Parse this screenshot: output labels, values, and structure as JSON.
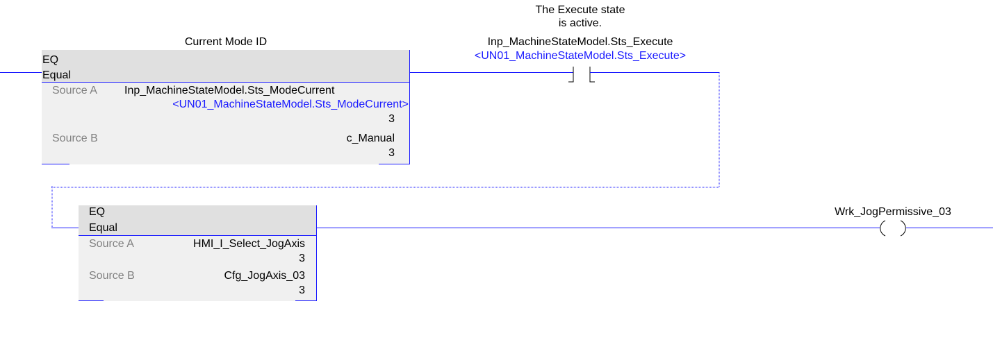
{
  "rung1": {
    "eq_block": {
      "caption": "Current Mode ID",
      "mnemonic": "EQ",
      "name": "Equal",
      "source_a_label": "Source A",
      "source_a_tag": "Inp_MachineStateModel.Sts_ModeCurrent",
      "source_a_alias": "<UN01_MachineStateModel.Sts_ModeCurrent>",
      "source_a_value": "3",
      "source_b_label": "Source B",
      "source_b_tag": "c_Manual",
      "source_b_value": "3"
    },
    "contact": {
      "description_line1": "The Execute state",
      "description_line2": "is active.",
      "tag": "Inp_MachineStateModel.Sts_Execute",
      "alias": "<UN01_MachineStateModel.Sts_Execute>"
    }
  },
  "rung2": {
    "eq_block": {
      "mnemonic": "EQ",
      "name": "Equal",
      "source_a_label": "Source A",
      "source_a_tag": "HMI_I_Select_JogAxis",
      "source_a_value": "3",
      "source_b_label": "Source B",
      "source_b_tag": "Cfg_JogAxis_03",
      "source_b_value": "3"
    },
    "coil": {
      "tag": "Wrk_JogPermissive_03"
    }
  },
  "colors": {
    "wire": "#1a1aff",
    "alias_text": "#1a1aff",
    "block_header": "#e0e0e0",
    "block_body": "#f0f0f0",
    "label_gray": "#808080"
  }
}
